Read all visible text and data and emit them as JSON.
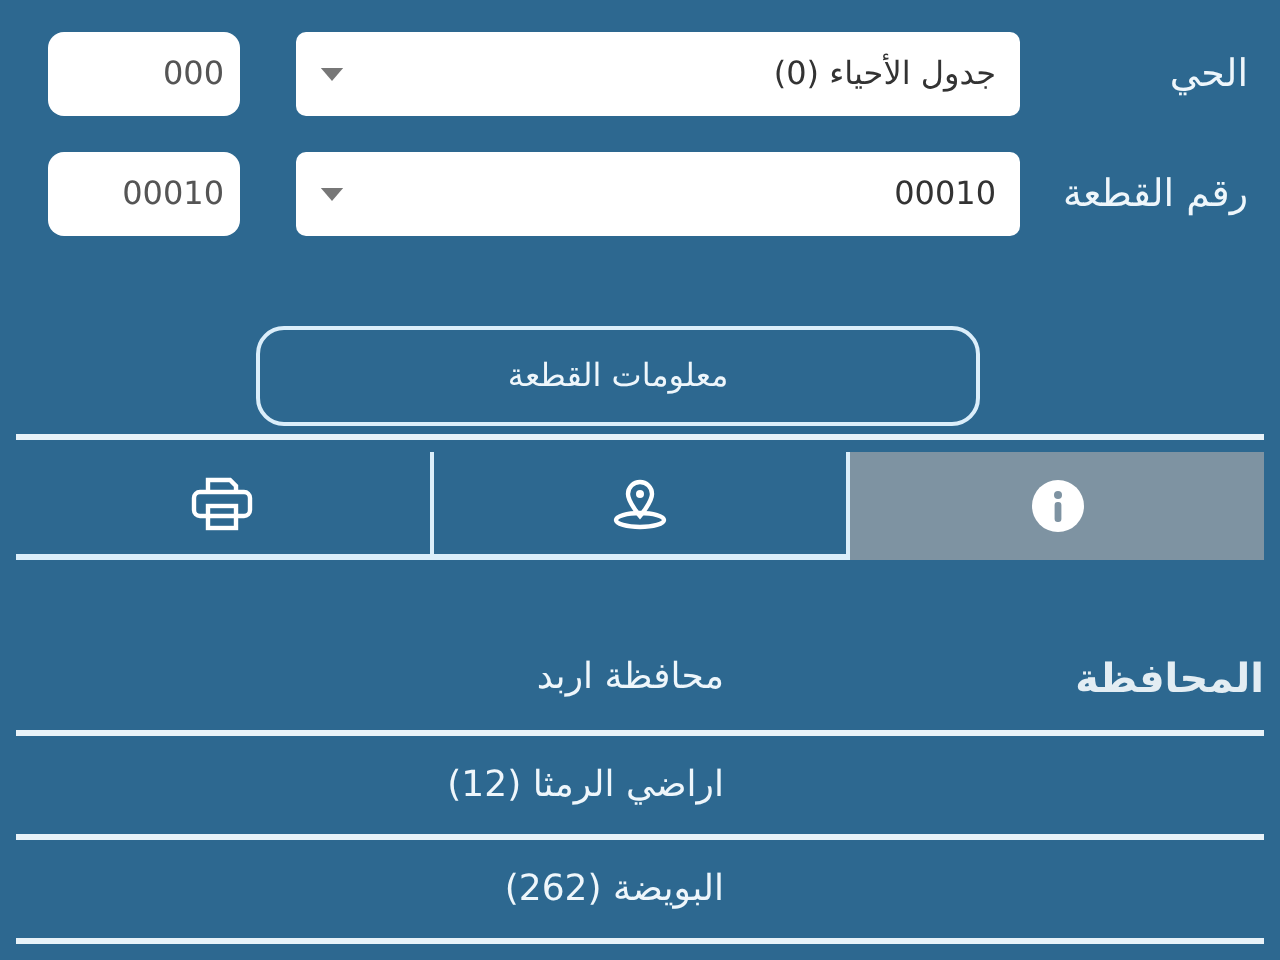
{
  "fields": [
    {
      "label": "الحي",
      "select_value": "جدول الأحياء (0)",
      "code": "000"
    },
    {
      "label": "رقم القطعة",
      "select_value": "00010",
      "code": "00010"
    }
  ],
  "info_button": "معلومات القطعة",
  "tabs": [
    {
      "kind": "info",
      "selected": true
    },
    {
      "kind": "location",
      "selected": false
    },
    {
      "kind": "print",
      "selected": false
    }
  ],
  "details": [
    {
      "label": "المحافظة",
      "value": "محافظة اربد"
    },
    {
      "value": "اراضي الرمثا (12)"
    },
    {
      "value": "البويضة (262)"
    }
  ]
}
